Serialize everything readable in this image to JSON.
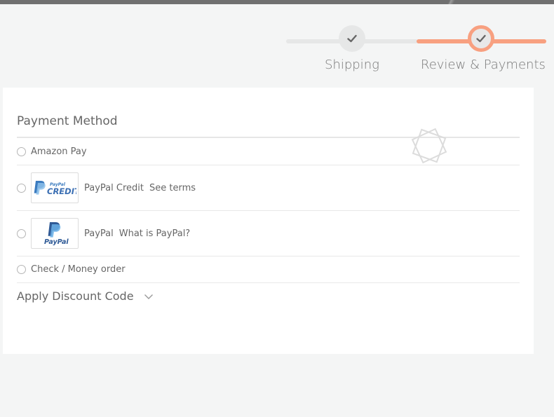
{
  "progress": {
    "steps": [
      {
        "label": "Shipping",
        "icon": "check-icon"
      },
      {
        "label": "Review & Payments",
        "icon": "check-icon"
      }
    ],
    "active_color": "#f8a080"
  },
  "payment": {
    "title": "Payment Method",
    "options": [
      {
        "label": "Amazon Pay"
      },
      {
        "label": "PayPal Credit",
        "link": "See terms",
        "logo": "paypal-credit-logo"
      },
      {
        "label": "PayPal",
        "link": "What is PayPal?",
        "logo": "paypal-logo"
      },
      {
        "label": "Check / Money order"
      }
    ]
  },
  "discount": {
    "label": "Apply Discount Code",
    "icon": "chevron-down-icon"
  }
}
